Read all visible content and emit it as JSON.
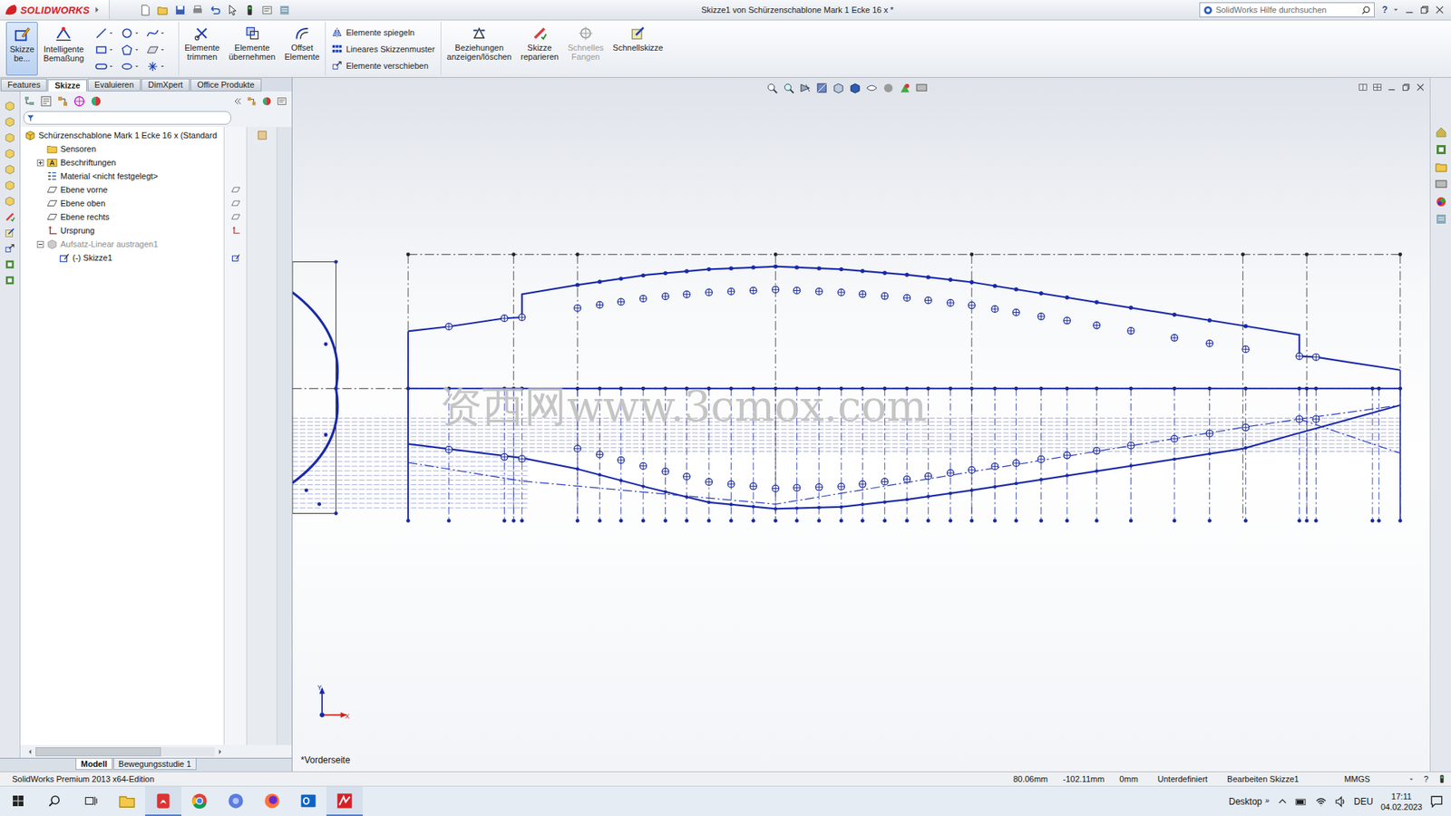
{
  "window": {
    "logo": "SOLIDWORKS",
    "title": "Skizze1 von Schürzenschablone Mark 1 Ecke 16 x *",
    "search_placeholder": "SolidWorks Hilfe durchsuchen",
    "help": "?"
  },
  "ribbon": {
    "main_buttons": [
      {
        "label": "Skizze\nbe...",
        "selected": true,
        "kind": "sketch"
      },
      {
        "label": "Intelligente\nBemaßung",
        "selected": false,
        "kind": "dim"
      }
    ],
    "edit_buttons": [
      {
        "label": "Elemente\ntrimmen",
        "kind": "trim"
      },
      {
        "label": "Elemente\nübernehmen",
        "kind": "convert"
      },
      {
        "label": "Offset\nElemente",
        "kind": "offset"
      }
    ],
    "list_buttons": [
      {
        "label": "Elemente spiegeln",
        "kind": "mirror"
      },
      {
        "label": "Lineares Skizzenmuster",
        "kind": "pattern"
      },
      {
        "label": "Elemente verschieben",
        "kind": "move"
      }
    ],
    "tail_buttons": [
      {
        "label": "Beziehungen\nanzeigen/löschen",
        "disabled": false,
        "kind": "relations"
      },
      {
        "label": "Skizze\nreparieren",
        "disabled": false,
        "kind": "repair"
      },
      {
        "label": "Schnelles\nFangen",
        "disabled": true,
        "kind": "snap"
      },
      {
        "label": "Schnellskizze",
        "disabled": false,
        "kind": "rapid"
      }
    ]
  },
  "tabs": [
    {
      "label": "Features",
      "selected": false
    },
    {
      "label": "Skizze",
      "selected": true
    },
    {
      "label": "Evaluieren",
      "selected": false
    },
    {
      "label": "DimXpert",
      "selected": false
    },
    {
      "label": "Office Produkte",
      "selected": false
    }
  ],
  "tree": {
    "root": "Schürzenschablone Mark 1 Ecke 16 x  (Standard",
    "items": [
      {
        "label": "Sensoren",
        "kind": "sensor",
        "depth": 1,
        "expandable": false,
        "expanded": false,
        "disabled": false
      },
      {
        "label": "Beschriftungen",
        "kind": "annotation",
        "depth": 1,
        "expandable": true,
        "expanded": false,
        "disabled": false
      },
      {
        "label": "Material <nicht festgelegt>",
        "kind": "material",
        "depth": 1,
        "expandable": false,
        "expanded": false,
        "disabled": false
      },
      {
        "label": "Ebene vorne",
        "kind": "plane",
        "depth": 1,
        "expandable": false,
        "expanded": false,
        "disabled": false
      },
      {
        "label": "Ebene oben",
        "kind": "plane",
        "depth": 1,
        "expandable": false,
        "expanded": false,
        "disabled": false
      },
      {
        "label": "Ebene rechts",
        "kind": "plane",
        "depth": 1,
        "expandable": false,
        "expanded": false,
        "disabled": false
      },
      {
        "label": "Ursprung",
        "kind": "origin",
        "depth": 1,
        "expandable": false,
        "expanded": false,
        "disabled": false
      },
      {
        "label": "Aufsatz-Linear austragen1",
        "kind": "feature",
        "depth": 1,
        "expandable": true,
        "expanded": true,
        "disabled": true
      },
      {
        "label": "(-) Skizze1",
        "kind": "sketch",
        "depth": 2,
        "expandable": false,
        "expanded": false,
        "disabled": false
      }
    ]
  },
  "view": {
    "label": "*Vorderseite",
    "axis_x": "X",
    "axis_y": "Y",
    "watermark": "资西网www.3cmox.com"
  },
  "model_tabs": [
    {
      "label": "Modell",
      "selected": true
    },
    {
      "label": "Bewegungsstudie 1",
      "selected": false
    }
  ],
  "status_bar": {
    "product": "SolidWorks Premium 2013 x64-Edition",
    "x": "80.06mm",
    "y": "-102.11mm",
    "z": "0mm",
    "state": "Unterdefiniert",
    "mode": "Bearbeiten Skizze1",
    "units": "MMGS",
    "help": "?"
  },
  "taskbar": {
    "apps": [
      {
        "kind": "explorer",
        "active": false
      },
      {
        "kind": "pdf",
        "active": true
      },
      {
        "kind": "chrome",
        "active": false
      },
      {
        "kind": "app",
        "active": false
      },
      {
        "kind": "firefox",
        "active": false
      },
      {
        "kind": "outlook",
        "active": false
      },
      {
        "kind": "solidworks",
        "active": true
      }
    ],
    "desktop": "Desktop",
    "chevron": "»",
    "language": "DEU",
    "time": "17:11",
    "date": "04.02.2023"
  }
}
